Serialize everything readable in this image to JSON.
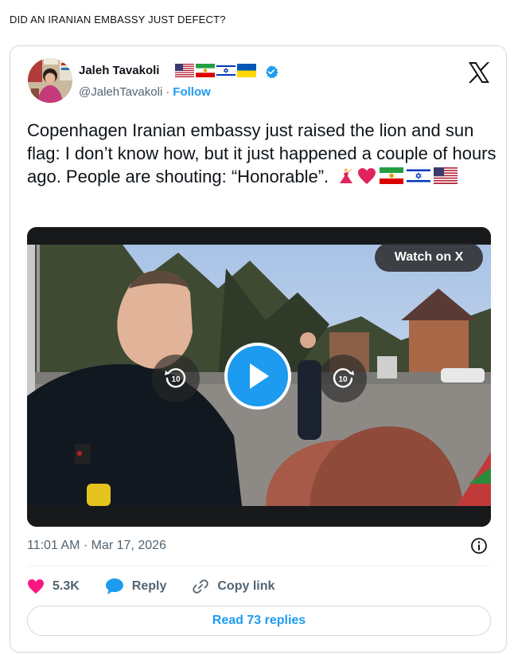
{
  "headline": "DID AN IRANIAN EMBASSY JUST DEFECT?",
  "tweet": {
    "author_name": "Jaleh Tavakoli",
    "handle": "@JalehTavakoli",
    "separator": "·",
    "follow_label": "Follow",
    "text": "Copenhagen Iranian embassy just raised the lion and sun flag: I don’t know how, but it just happened a couple of hours ago. People are shouting: “Honorable”.",
    "timestamp": "11:01 AM · Mar 17, 2026",
    "name_flags": [
      "us-flag-icon",
      "iran-lion-sun-flag-icon",
      "israel-flag-icon",
      "ukraine-flag-icon"
    ],
    "text_emojis": [
      "dancer-icon",
      "red-heart-icon",
      "iran-lion-sun-flag-icon",
      "israel-flag-icon",
      "us-flag-icon"
    ]
  },
  "media": {
    "watch_label": "Watch on X",
    "skip_back_label": "10",
    "skip_forward_label": "10"
  },
  "actions": {
    "like_count": "5.3K",
    "reply_label": "Reply",
    "copy_label": "Copy link"
  },
  "read_replies_label": "Read 73 replies",
  "colors": {
    "accent": "#1d9bf0",
    "like": "#f91880",
    "text": "#0f1419",
    "muted": "#536471",
    "border": "#cfd9de"
  }
}
